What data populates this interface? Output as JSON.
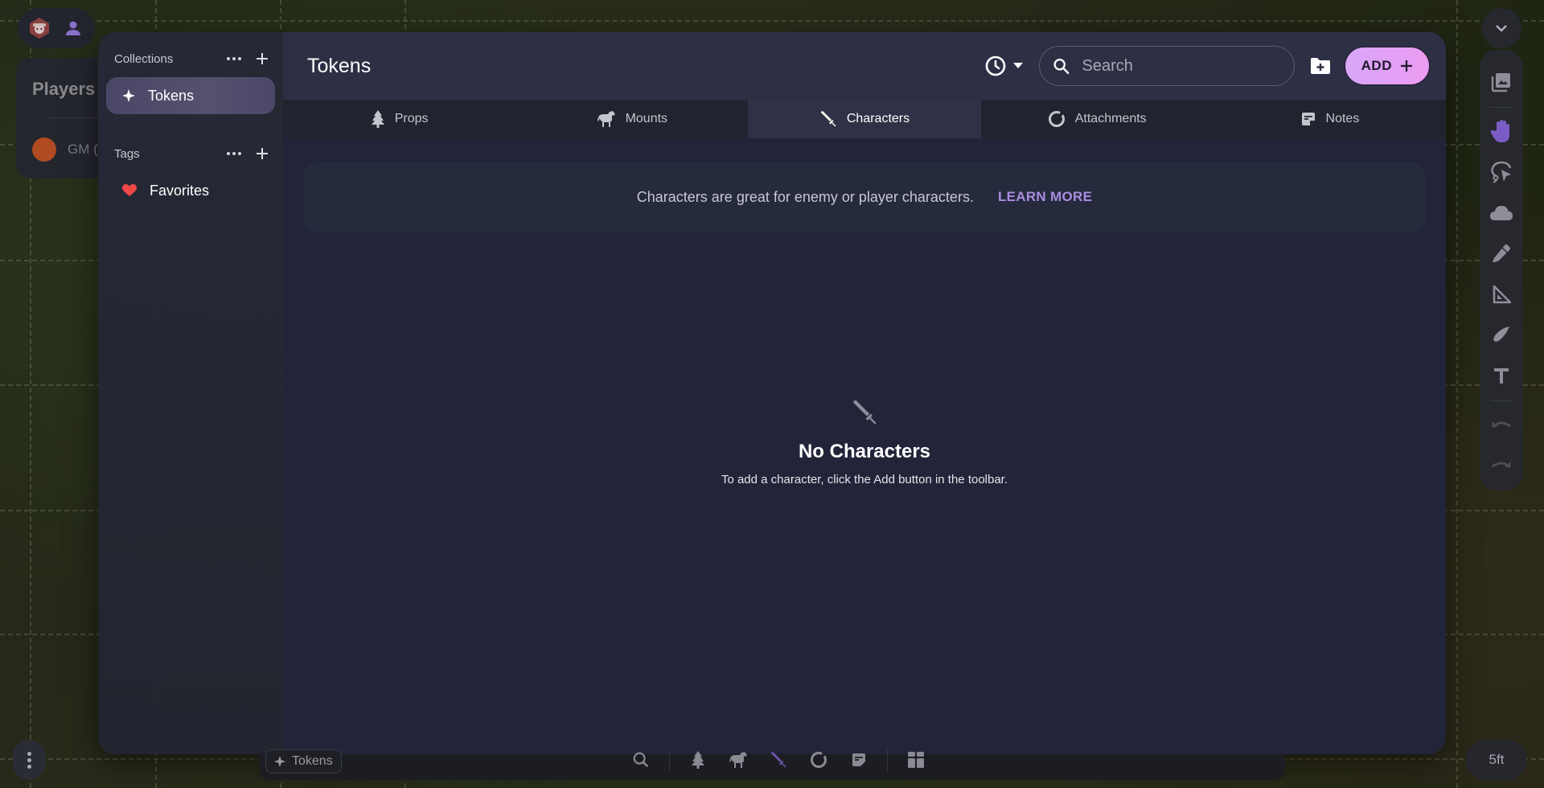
{
  "top_left": {
    "logo_icon": "bear-hex-logo-icon",
    "profile_icon": "person-icon"
  },
  "players_panel": {
    "title": "Players",
    "players": [
      {
        "name": "GM (",
        "color": "#b04b22"
      }
    ]
  },
  "sidebar": {
    "collections": {
      "title": "Collections",
      "items": [
        {
          "label": "Tokens",
          "icon": "sparkle-icon",
          "active": true
        }
      ]
    },
    "tags": {
      "title": "Tags",
      "items": [
        {
          "label": "Favorites",
          "icon": "heart-icon",
          "color": "#ef4848"
        }
      ]
    }
  },
  "header": {
    "title": "Tokens",
    "history_icon": "clock-icon",
    "search_placeholder": "Search",
    "search_value": "",
    "new_folder_icon": "folder-plus-icon",
    "add_label": "ADD",
    "add_icon": "plus-icon"
  },
  "tabs": [
    {
      "label": "Props",
      "icon": "tree-icon",
      "active": false
    },
    {
      "label": "Mounts",
      "icon": "horse-icon",
      "active": false
    },
    {
      "label": "Characters",
      "icon": "sword-icon",
      "active": true
    },
    {
      "label": "Attachments",
      "icon": "ring-icon",
      "active": false
    },
    {
      "label": "Notes",
      "icon": "note-icon",
      "active": false
    }
  ],
  "info_banner": {
    "text": "Characters are great for enemy or player characters.",
    "link": "LEARN MORE"
  },
  "empty_state": {
    "icon": "sword-icon",
    "title": "No Characters",
    "description": "To add a character, click the Add button in the toolbar."
  },
  "right_toolbar": {
    "collapse_icon": "chevron-down-icon",
    "tools": [
      {
        "name": "asset-library",
        "icon": "images-icon"
      },
      {
        "name": "move",
        "icon": "hand-icon",
        "active": true
      },
      {
        "name": "select",
        "icon": "lasso-pointer-icon"
      },
      {
        "name": "fog",
        "icon": "cloud-icon"
      },
      {
        "name": "draw",
        "icon": "pen-icon"
      },
      {
        "name": "measure",
        "icon": "ruler-triangle-icon"
      },
      {
        "name": "pointer",
        "icon": "feather-icon"
      },
      {
        "name": "text",
        "icon": "text-icon"
      },
      {
        "name": "undo",
        "icon": "undo-icon",
        "disabled": true
      },
      {
        "name": "redo",
        "icon": "redo-icon",
        "disabled": true
      }
    ]
  },
  "bottom": {
    "chip_label": "Tokens",
    "scale_label": "5ft"
  },
  "colors": {
    "accent": "#a98de0",
    "add_button_start": "#d8a6f8",
    "add_button_end": "#ec9cf2",
    "active_tool": "#7b5cc4"
  }
}
